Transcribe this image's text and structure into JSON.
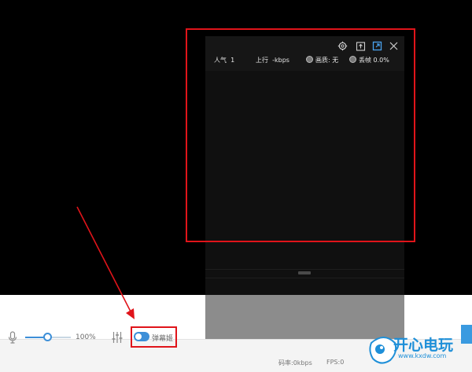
{
  "panel": {
    "popularity_label": "人气",
    "popularity_value": "1",
    "upload_label": "上行",
    "upload_value": "-kbps",
    "quality_label": "画质: 无",
    "frame_drop_label": "丢帧 0.0%",
    "icons": [
      "gear-icon",
      "export-icon",
      "pin-icon",
      "close-icon"
    ]
  },
  "toolbar": {
    "volume_percent": "100%",
    "volume_level": 0.5,
    "danmaku_label": "弹幕姬",
    "danmaku_on": true
  },
  "status": {
    "bitrate": "码率:0kbps",
    "fps": "FPS:0"
  },
  "watermark": {
    "text": "开心电玩",
    "url": "www.kxdw.com"
  },
  "colors": {
    "accent": "#3d8fd8",
    "highlight": "#e0141a",
    "panel_bg": "#101010"
  }
}
